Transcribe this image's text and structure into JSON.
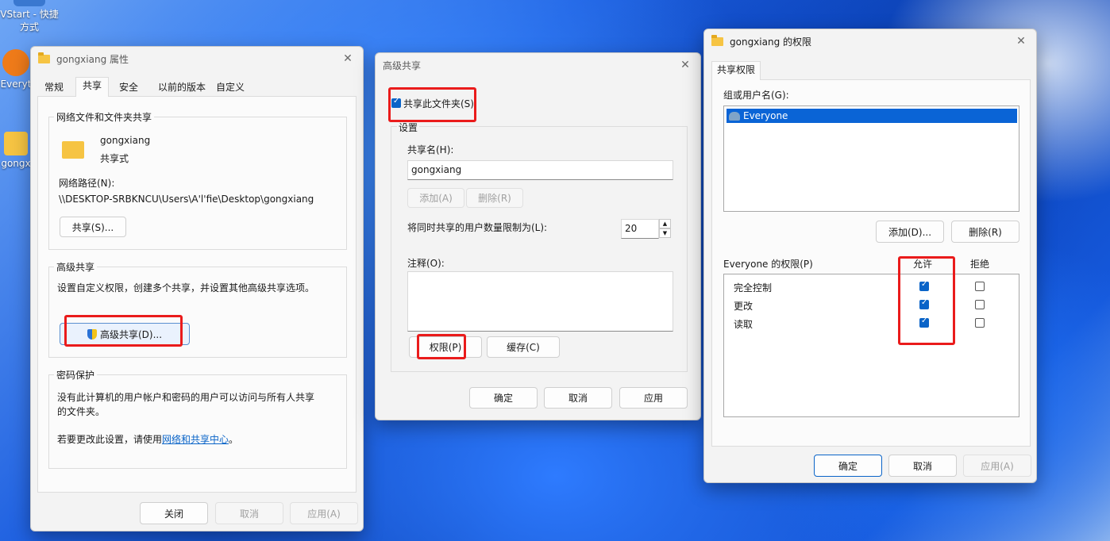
{
  "desktop": {
    "icons": [
      {
        "label": "VStart - 快捷方式"
      },
      {
        "label": "Everyt"
      },
      {
        "label": "gongx"
      }
    ]
  },
  "props": {
    "title": "gongxiang 属性",
    "tabs": [
      "常规",
      "共享",
      "安全",
      "以前的版本",
      "自定义"
    ],
    "net_group_title": "网络文件和文件夹共享",
    "folder_name": "gongxiang",
    "folder_status": "共享式",
    "net_path_label": "网络路径(N):",
    "net_path_value": "\\\\DESKTOP-SRBKNCU\\Users\\A'l'fie\\Desktop\\gongxiang",
    "share_button": "共享(S)...",
    "adv_group_title": "高级共享",
    "adv_desc": "设置自定义权限，创建多个共享，并设置其他高级共享选项。",
    "adv_button": "高级共享(D)...",
    "pw_group_title": "密码保护",
    "pw_desc": "没有此计算机的用户帐户和密码的用户可以访问与所有人共享的文件夹。",
    "pw_change_prefix": "若要更改此设置，请使用",
    "pw_change_link": "网络和共享中心",
    "pw_change_suffix": "。",
    "close_button": "关闭",
    "cancel_button": "取消",
    "apply_button": "应用(A)"
  },
  "advanced": {
    "title": "高级共享",
    "share_checkbox": "共享此文件夹(S)",
    "share_checked": true,
    "settings_title": "设置",
    "share_name_label": "共享名(H):",
    "share_name_value": "gongxiang",
    "add_button": "添加(A)",
    "remove_button": "删除(R)",
    "limit_label": "将同时共享的用户数量限制为(L):",
    "limit_value": "20",
    "comment_label": "注释(O):",
    "comment_value": "",
    "permissions_button": "权限(P)",
    "cache_button": "缓存(C)",
    "ok_button": "确定",
    "cancel_button": "取消",
    "apply_button": "应用"
  },
  "perms": {
    "title": "gongxiang 的权限",
    "tab": "共享权限",
    "group_label": "组或用户名(G):",
    "users": [
      "Everyone"
    ],
    "add_button": "添加(D)...",
    "remove_button": "删除(R)",
    "perm_label": "Everyone 的权限(P)",
    "allow_header": "允许",
    "deny_header": "拒绝",
    "rows": [
      {
        "name": "完全控制",
        "allow": true,
        "deny": false
      },
      {
        "name": "更改",
        "allow": true,
        "deny": false
      },
      {
        "name": "读取",
        "allow": true,
        "deny": false
      }
    ],
    "ok_button": "确定",
    "cancel_button": "取消",
    "apply_button": "应用(A)"
  }
}
